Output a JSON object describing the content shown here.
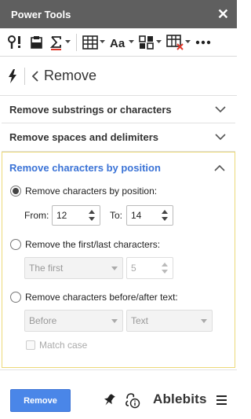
{
  "window": {
    "title": "Power Tools"
  },
  "breadcrumb": {
    "title": "Remove"
  },
  "sections": [
    {
      "label": "Remove substrings or characters"
    },
    {
      "label": "Remove spaces and delimiters"
    }
  ],
  "expanded": {
    "label": "Remove characters by position",
    "option1": {
      "label": "Remove characters by position:",
      "from_label": "From:",
      "from_value": "12",
      "to_label": "To:",
      "to_value": "14"
    },
    "option2": {
      "label": "Remove the first/last characters:",
      "select_value": "The first",
      "count_value": "5"
    },
    "option3": {
      "label": "Remove characters before/after text:",
      "select_value": "Before",
      "text_placeholder": "Text",
      "match_case_label": "Match case"
    }
  },
  "footer": {
    "remove_label": "Remove",
    "brand": "Ablebits"
  },
  "colors": {
    "titlebar": "#5f5f5f",
    "accent": "#4a86e8",
    "section_active": "#3b73d6",
    "highlight_border": "#ecd978"
  }
}
